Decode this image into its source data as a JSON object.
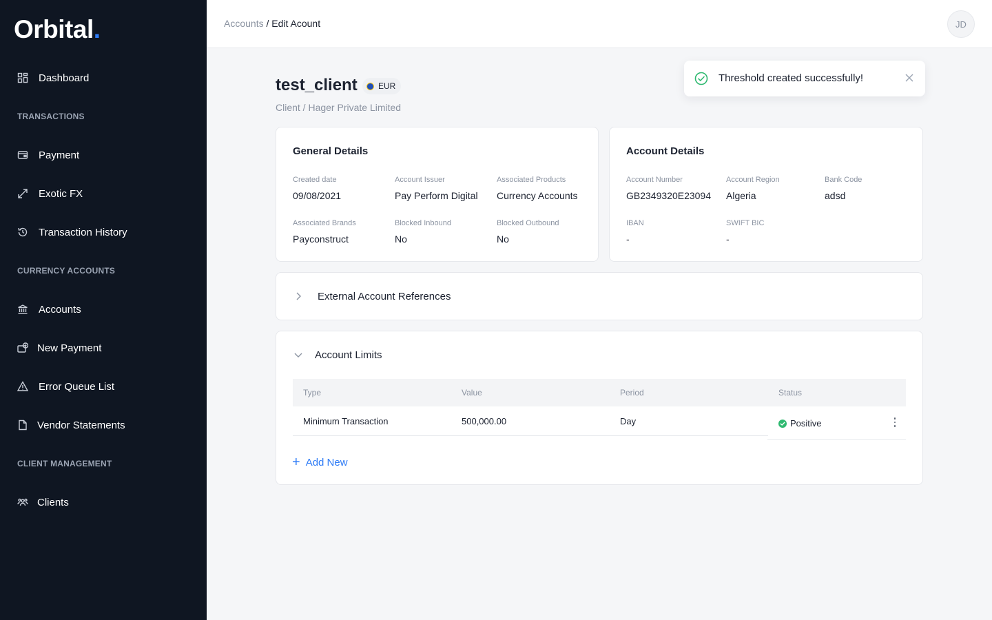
{
  "brand": {
    "name": "Orbital",
    "dot": "."
  },
  "sidebar": {
    "dashboard": "Dashboard",
    "sections": {
      "transactions": "TRANSACTIONS",
      "currency_accounts": "CURRENCY ACCOUNTS",
      "client_management": "CLIENT MANAGEMENT"
    },
    "items": [
      {
        "label": "Dashboard",
        "icon": "dashboard-icon"
      },
      {
        "label": "Payment",
        "icon": "wallet-icon"
      },
      {
        "label": "Exotic FX",
        "icon": "arrows-expand-icon"
      },
      {
        "label": "Transaction History",
        "icon": "history-icon"
      },
      {
        "label": "Accounts",
        "icon": "bank-icon"
      },
      {
        "label": "New Payment",
        "icon": "new-payment-icon"
      },
      {
        "label": "Error Queue List",
        "icon": "warning-icon"
      },
      {
        "label": "Vendor Statements",
        "icon": "document-icon"
      },
      {
        "label": "Clients",
        "icon": "users-icon"
      }
    ]
  },
  "topbar": {
    "breadcrumb_link": "Accounts",
    "breadcrumb_current": " / Edit Acount",
    "avatar_initials": "JD"
  },
  "header": {
    "title": "test_client",
    "currency": "EUR",
    "subtitle": "Client / Hager Private Limited"
  },
  "toast": {
    "message": "Threshold created successfully!",
    "icon": "check-circle-icon"
  },
  "general_details": {
    "title": "General Details",
    "fields": [
      {
        "label": "Created date",
        "value": "09/08/2021"
      },
      {
        "label": "Account Issuer",
        "value": "Pay Perform Digital"
      },
      {
        "label": "Associated Products",
        "value": "Currency Accounts"
      },
      {
        "label": "Associated Brands",
        "value": "Payconstruct"
      },
      {
        "label": "Blocked Inbound",
        "value": "No"
      },
      {
        "label": "Blocked Outbound",
        "value": "No"
      }
    ]
  },
  "account_details": {
    "title": "Account Details",
    "fields": [
      {
        "label": "Account Number",
        "value": "GB2349320E23094"
      },
      {
        "label": "Account Region",
        "value": "Algeria"
      },
      {
        "label": "Bank Code",
        "value": "adsd"
      },
      {
        "label": "IBAN",
        "value": "-"
      },
      {
        "label": "SWIFT BIC",
        "value": "-"
      }
    ]
  },
  "external_refs": {
    "title": "External Account References"
  },
  "account_limits": {
    "title": "Account Limits",
    "columns": [
      "Type",
      "Value",
      "Period",
      "Status"
    ],
    "rows": [
      {
        "type": "Minimum Transaction",
        "value": "500,000.00",
        "period": "Day",
        "status": "Positive"
      }
    ],
    "add_new": "Add New"
  },
  "colors": {
    "sidebar_bg": "#0f1622",
    "accent": "#2f7cf6",
    "success": "#2fb970"
  }
}
